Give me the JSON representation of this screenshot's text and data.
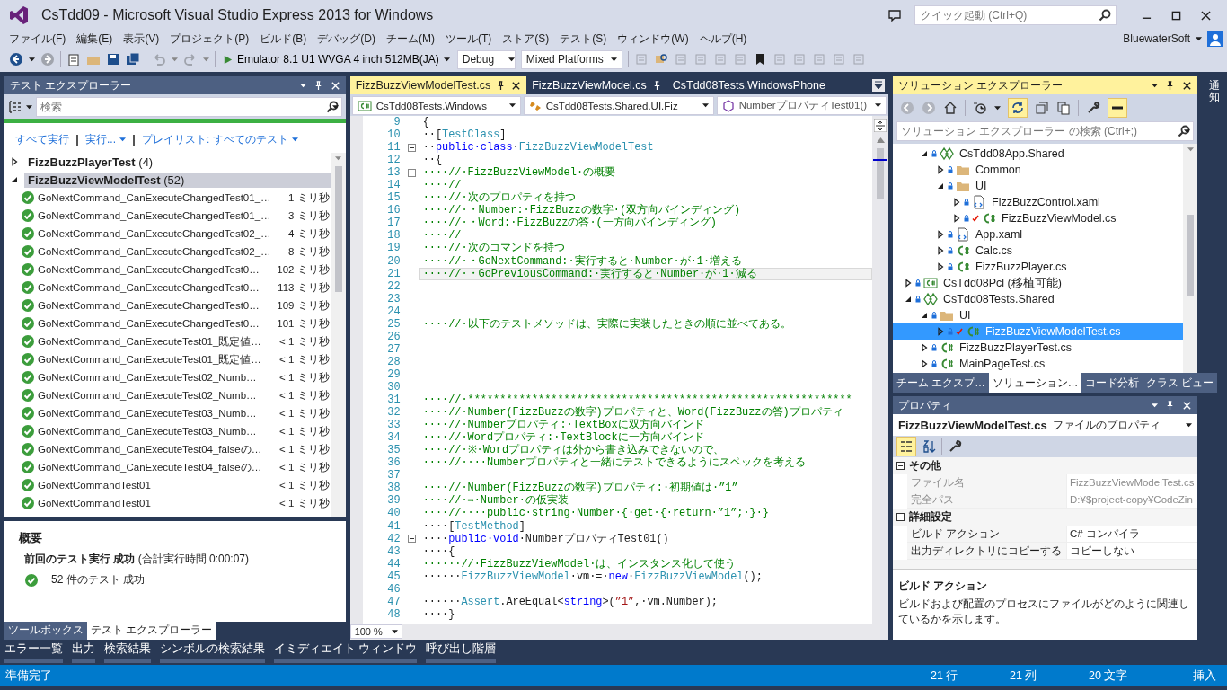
{
  "window": {
    "title": "CsTdd09 - Microsoft Visual Studio Express 2013 for Windows",
    "quick_launch": {
      "placeholder": "クイック起動 (Ctrl+Q)"
    },
    "user": "BluewaterSoft"
  },
  "menu": [
    "ファイル(F)",
    "編集(E)",
    "表示(V)",
    "プロジェクト(P)",
    "ビルド(B)",
    "デバッグ(D)",
    "チーム(M)",
    "ツール(T)",
    "ストア(S)",
    "テスト(S)",
    "ウィンドウ(W)",
    "ヘルプ(H)"
  ],
  "toolbar": {
    "run_target": "Emulator 8.1 U1 WVGA 4 inch 512MB(JA)",
    "configuration": "Debug",
    "platform": "Mixed Platforms"
  },
  "test_explorer": {
    "title": "テスト エクスプローラー",
    "search": {
      "placeholder": "検索"
    },
    "links": [
      "すべて実行",
      "実行...",
      "プレイリスト: すべてのテスト"
    ],
    "groups": [
      {
        "name": "FizzBuzzPlayerTest",
        "count": "(4)",
        "expanded": false,
        "selected": false
      },
      {
        "name": "FizzBuzzViewModelTest",
        "count": "(52)",
        "expanded": true,
        "selected": true,
        "tests": [
          {
            "name": "GoNextCommand_CanExecuteChangedTest01_…",
            "duration": "1 ミリ秒"
          },
          {
            "name": "GoNextCommand_CanExecuteChangedTest01_…",
            "duration": "3 ミリ秒"
          },
          {
            "name": "GoNextCommand_CanExecuteChangedTest02_…",
            "duration": "4 ミリ秒"
          },
          {
            "name": "GoNextCommand_CanExecuteChangedTest02_…",
            "duration": "8 ミリ秒"
          },
          {
            "name": "GoNextCommand_CanExecuteChangedTest0…",
            "duration": "102 ミリ秒"
          },
          {
            "name": "GoNextCommand_CanExecuteChangedTest0…",
            "duration": "113 ミリ秒"
          },
          {
            "name": "GoNextCommand_CanExecuteChangedTest0…",
            "duration": "109 ミリ秒"
          },
          {
            "name": "GoNextCommand_CanExecuteChangedTest0…",
            "duration": "101 ミリ秒"
          },
          {
            "name": "GoNextCommand_CanExecuteTest01_既定値…",
            "duration": "< 1 ミリ秒"
          },
          {
            "name": "GoNextCommand_CanExecuteTest01_既定値…",
            "duration": "< 1 ミリ秒"
          },
          {
            "name": "GoNextCommand_CanExecuteTest02_Numb…",
            "duration": "< 1 ミリ秒"
          },
          {
            "name": "GoNextCommand_CanExecuteTest02_Numb…",
            "duration": "< 1 ミリ秒"
          },
          {
            "name": "GoNextCommand_CanExecuteTest03_Numb…",
            "duration": "< 1 ミリ秒"
          },
          {
            "name": "GoNextCommand_CanExecuteTest03_Numb…",
            "duration": "< 1 ミリ秒"
          },
          {
            "name": "GoNextCommand_CanExecuteTest04_falseの…",
            "duration": "< 1 ミリ秒"
          },
          {
            "name": "GoNextCommand_CanExecuteTest04_falseの…",
            "duration": "< 1 ミリ秒"
          },
          {
            "name": "GoNextCommandTest01",
            "duration": "< 1 ミリ秒"
          },
          {
            "name": "GoNextCommandTest01",
            "duration": "< 1 ミリ秒"
          }
        ]
      }
    ],
    "summary": {
      "heading": "概要",
      "last_run": "**前回のテスト実行 成功** (合計実行時間 0:00:07)",
      "result": "52 件のテスト 成功"
    },
    "tabs": [
      {
        "label": "ツールボックス",
        "selected": false
      },
      {
        "label": "テスト エクスプローラー",
        "selected": true
      }
    ]
  },
  "editor": {
    "tabs": [
      {
        "label": "FizzBuzzViewModelTest.cs",
        "selected": true
      },
      {
        "label": "FizzBuzzViewModel.cs",
        "selected": false
      },
      {
        "label": "CsTdd08Tests.WindowsPhone",
        "selected": false
      }
    ],
    "navigation": [
      "CsTdd08Tests.Windows",
      "CsTdd08Tests.Shared.UI.Fiz",
      "NumberプロパティTest01()"
    ],
    "zoom": "100 %",
    "lines": [
      {
        "number": "9",
        "fold": false,
        "current": false,
        "tokens": [
          {
            "kind": "plain",
            "text": "{"
          }
        ]
      },
      {
        "number": "10",
        "fold": false,
        "current": false,
        "tokens": [
          {
            "kind": "plain",
            "text": "··["
          },
          {
            "kind": "type",
            "text": "TestClass"
          },
          {
            "kind": "plain",
            "text": "]"
          }
        ]
      },
      {
        "number": "11",
        "fold": true,
        "current": false,
        "tokens": [
          {
            "kind": "plain",
            "text": "··"
          },
          {
            "kind": "keyword",
            "text": "public·class"
          },
          {
            "kind": "plain",
            "text": "·"
          },
          {
            "kind": "type",
            "text": "FizzBuzzViewModelTest"
          }
        ]
      },
      {
        "number": "12",
        "fold": false,
        "current": false,
        "tokens": [
          {
            "kind": "plain",
            "text": "··{"
          }
        ]
      },
      {
        "number": "13",
        "fold": true,
        "current": false,
        "tokens": [
          {
            "kind": "comment",
            "text": "····//·FizzBuzzViewModel·の概要"
          }
        ]
      },
      {
        "number": "14",
        "fold": false,
        "current": false,
        "tokens": [
          {
            "kind": "comment",
            "text": "····//"
          }
        ]
      },
      {
        "number": "15",
        "fold": false,
        "current": false,
        "tokens": [
          {
            "kind": "comment",
            "text": "····//·次のプロパティを持つ"
          }
        ]
      },
      {
        "number": "16",
        "fold": false,
        "current": false,
        "tokens": [
          {
            "kind": "comment",
            "text": "····//·・Number:·FizzBuzzの数字·(双方向バインディング)"
          }
        ]
      },
      {
        "number": "17",
        "fold": false,
        "current": false,
        "tokens": [
          {
            "kind": "comment",
            "text": "····//·・Word:·FizzBuzzの答·(一方向バインディング)"
          }
        ]
      },
      {
        "number": "18",
        "fold": false,
        "current": false,
        "tokens": [
          {
            "kind": "comment",
            "text": "····//"
          }
        ]
      },
      {
        "number": "19",
        "fold": false,
        "current": false,
        "tokens": [
          {
            "kind": "comment",
            "text": "····//·次のコマンドを持つ"
          }
        ]
      },
      {
        "number": "20",
        "fold": false,
        "current": false,
        "tokens": [
          {
            "kind": "comment",
            "text": "····//·・GoNextCommand:·実行すると·Number·が·1·増える"
          }
        ]
      },
      {
        "number": "21",
        "fold": false,
        "current": true,
        "tokens": [
          {
            "kind": "comment",
            "text": "····//·・GoPreviousCommand:·実行すると·Number·が·1·減る"
          }
        ]
      },
      {
        "number": "22",
        "fold": false,
        "current": false
      },
      {
        "number": "23",
        "fold": false,
        "current": false
      },
      {
        "number": "24",
        "fold": false,
        "current": false
      },
      {
        "number": "25",
        "fold": false,
        "current": false,
        "tokens": [
          {
            "kind": "comment",
            "text": "····//·以下のテストメソッドは、実際に実装したときの順に並べてある。"
          }
        ]
      },
      {
        "number": "26",
        "fold": false,
        "current": false
      },
      {
        "number": "27",
        "fold": false,
        "current": false
      },
      {
        "number": "28",
        "fold": false,
        "current": false
      },
      {
        "number": "29",
        "fold": false,
        "current": false
      },
      {
        "number": "30",
        "fold": false,
        "current": false
      },
      {
        "number": "31",
        "fold": false,
        "current": false,
        "tokens": [
          {
            "kind": "comment",
            "text": "····//·************************************************************"
          }
        ]
      },
      {
        "number": "32",
        "fold": false,
        "current": false,
        "tokens": [
          {
            "kind": "comment",
            "text": "····//·Number(FizzBuzzの数字)プロパティと、Word(FizzBuzzの答)プロパティ"
          }
        ]
      },
      {
        "number": "33",
        "fold": false,
        "current": false,
        "tokens": [
          {
            "kind": "comment",
            "text": "····//·Numberプロパティ:·TextBoxに双方向バインド"
          }
        ]
      },
      {
        "number": "34",
        "fold": false,
        "current": false,
        "tokens": [
          {
            "kind": "comment",
            "text": "····//·Wordプロパティ:·TextBlockに一方向バインド"
          }
        ]
      },
      {
        "number": "35",
        "fold": false,
        "current": false,
        "tokens": [
          {
            "kind": "comment",
            "text": "····//·※·Wordプロパティは外から書き込みできないので、"
          }
        ]
      },
      {
        "number": "36",
        "fold": false,
        "current": false,
        "tokens": [
          {
            "kind": "comment",
            "text": "····//····Numberプロパティと一緒にテストできるようにスペックを考える"
          }
        ]
      },
      {
        "number": "37",
        "fold": false,
        "current": false
      },
      {
        "number": "38",
        "fold": false,
        "current": false,
        "tokens": [
          {
            "kind": "comment",
            "text": "····//·Number(FizzBuzzの数字)プロパティ:·初期値は·”1”"
          }
        ]
      },
      {
        "number": "39",
        "fold": false,
        "current": false,
        "tokens": [
          {
            "kind": "comment",
            "text": "····//·⇒·Number·の仮実装"
          }
        ]
      },
      {
        "number": "40",
        "fold": false,
        "current": false,
        "tokens": [
          {
            "kind": "comment",
            "text": "····//····public·string·Number·{·get·{·return·”1”;·}·}"
          }
        ]
      },
      {
        "number": "41",
        "fold": false,
        "current": false,
        "tokens": [
          {
            "kind": "plain",
            "text": "····["
          },
          {
            "kind": "type",
            "text": "TestMethod"
          },
          {
            "kind": "plain",
            "text": "]"
          }
        ]
      },
      {
        "number": "42",
        "fold": true,
        "current": false,
        "tokens": [
          {
            "kind": "plain",
            "text": "····"
          },
          {
            "kind": "keyword",
            "text": "public·void"
          },
          {
            "kind": "plain",
            "text": "·NumberプロパティTest01()"
          }
        ]
      },
      {
        "number": "43",
        "fold": false,
        "current": false,
        "tokens": [
          {
            "kind": "plain",
            "text": "····{"
          }
        ]
      },
      {
        "number": "44",
        "fold": false,
        "current": false,
        "tokens": [
          {
            "kind": "comment",
            "text": "······//·FizzBuzzViewModel·は、インスタンス化して使う"
          }
        ]
      },
      {
        "number": "45",
        "fold": false,
        "current": false,
        "tokens": [
          {
            "kind": "plain",
            "text": "······"
          },
          {
            "kind": "type",
            "text": "FizzBuzzViewModel"
          },
          {
            "kind": "plain",
            "text": "·vm·=·"
          },
          {
            "kind": "keyword",
            "text": "new"
          },
          {
            "kind": "plain",
            "text": "·"
          },
          {
            "kind": "type",
            "text": "FizzBuzzViewModel"
          },
          {
            "kind": "plain",
            "text": "();"
          }
        ]
      },
      {
        "number": "46",
        "fold": false,
        "current": false
      },
      {
        "number": "47",
        "fold": false,
        "current": false,
        "tokens": [
          {
            "kind": "plain",
            "text": "······"
          },
          {
            "kind": "type",
            "text": "Assert"
          },
          {
            "kind": "plain",
            "text": ".AreEqual<"
          },
          {
            "kind": "keyword",
            "text": "string"
          },
          {
            "kind": "plain",
            "text": ">("
          },
          {
            "kind": "string",
            "text": "”1”"
          },
          {
            "kind": "plain",
            "text": ",·vm.Number);"
          }
        ]
      },
      {
        "number": "48",
        "fold": false,
        "current": false,
        "tokens": [
          {
            "kind": "plain",
            "text": "····}"
          }
        ]
      }
    ]
  },
  "solution_explorer": {
    "title": "ソリューション エクスプローラー",
    "search": {
      "placeholder": "ソリューション エクスプローラー の検索 (Ctrl+;)"
    },
    "nested_items": [
      {
        "label": "CsTdd08App.Shared",
        "kind": "shared",
        "expanded": true,
        "selected": false,
        "pending_edit": false,
        "children": [
          {
            "label": "Common",
            "kind": "folder",
            "expanded": false,
            "selected": false,
            "pending_edit": false
          },
          {
            "label": "UI",
            "kind": "folder",
            "expanded": true,
            "selected": false,
            "pending_edit": false,
            "children": [
              {
                "label": "FizzBuzzControl.xaml",
                "kind": "xaml",
                "expanded": false,
                "selected": false,
                "pending_edit": false
              },
              {
                "label": "FizzBuzzViewModel.cs",
                "kind": "cs",
                "expanded": false,
                "selected": false,
                "pending_edit": true
              }
            ]
          },
          {
            "label": "App.xaml",
            "kind": "xaml",
            "expanded": false,
            "selected": false,
            "pending_edit": false
          },
          {
            "label": "Calc.cs",
            "kind": "cs",
            "expanded": false,
            "selected": false,
            "pending_edit": false
          },
          {
            "label": "FizzBuzzPlayer.cs",
            "kind": "cs",
            "expanded": false,
            "selected": false,
            "pending_edit": false
          }
        ]
      }
    ],
    "items": [
      {
        "label": "CsTdd08Pcl (移植可能)",
        "kind": "project",
        "expanded": false,
        "selected": false,
        "pending_edit": false
      },
      {
        "label": "CsTdd08Tests.Shared",
        "kind": "shared",
        "expanded": true,
        "selected": false,
        "pending_edit": false,
        "children": [
          {
            "label": "UI",
            "kind": "folder",
            "expanded": true,
            "selected": false,
            "pending_edit": false,
            "children": [
              {
                "label": "FizzBuzzViewModelTest.cs",
                "kind": "cs",
                "expanded": false,
                "selected": true,
                "pending_edit": true
              }
            ]
          },
          {
            "label": "FizzBuzzPlayerTest.cs",
            "kind": "cs",
            "expanded": false,
            "selected": false,
            "pending_edit": false
          },
          {
            "label": "MainPageTest.cs",
            "kind": "cs",
            "expanded": false,
            "selected": false,
            "pending_edit": false
          }
        ]
      }
    ],
    "tabs": [
      {
        "label": "チーム エクスプ…",
        "selected": false
      },
      {
        "label": "ソリューション…",
        "selected": true
      },
      {
        "label": "コード分析",
        "selected": false
      },
      {
        "label": "クラス ビュー",
        "selected": false
      }
    ]
  },
  "properties": {
    "title": "プロパティ",
    "object": "FizzBuzzViewModelTest.cs",
    "object_type": "ファイルのプロパティ",
    "categories": [
      {
        "name": "その他",
        "rows": [
          {
            "name": "ファイル名",
            "value": "FizzBuzzViewModelTest.cs",
            "disabled": true
          },
          {
            "name": "完全パス",
            "value": "D:¥$project-copy¥CodeZin",
            "disabled": true
          }
        ]
      },
      {
        "name": "詳細設定",
        "rows": [
          {
            "name": "ビルド アクション",
            "value": "C# コンパイラ",
            "disabled": false
          },
          {
            "name": "出力ディレクトリにコピーする",
            "value": "コピーしない",
            "disabled": false
          }
        ]
      }
    ],
    "description_title": "ビルド アクション",
    "description": "ビルドおよび配置のプロセスにファイルがどのように関連しているかを示します。"
  },
  "notifications_label": "通知",
  "tool_tabs": [
    "エラー一覧",
    "出力",
    "検索結果",
    "シンボルの検索結果",
    "イミディエイト ウィンドウ",
    "呼び出し階層"
  ],
  "status_bar": {
    "message": "準備完了",
    "line": "21 行",
    "column": "21 列",
    "character": "20 文字",
    "mode": "挿入"
  }
}
